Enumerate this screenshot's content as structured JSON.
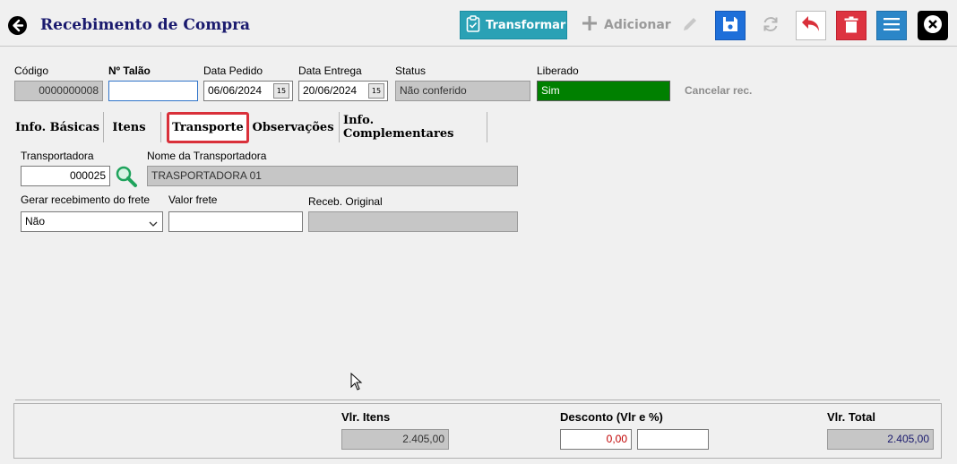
{
  "header": {
    "title": "Recebimento de Compra",
    "transformar_label": "Transformar",
    "adicionar_label": "Adicionar"
  },
  "form": {
    "codigo": {
      "label": "Código",
      "value": "0000000008"
    },
    "talao": {
      "label": "Nº Talão",
      "value": ""
    },
    "data_pedido": {
      "label": "Data Pedido",
      "value": "06/06/2024"
    },
    "data_entrega": {
      "label": "Data Entrega",
      "value": "20/06/2024"
    },
    "status": {
      "label": "Status",
      "value": "Não conferido"
    },
    "liberado": {
      "label": "Liberado",
      "value": "Sim"
    },
    "cancelar_label": "Cancelar rec."
  },
  "tabs": [
    {
      "label": "Info. Básicas"
    },
    {
      "label": "Itens"
    },
    {
      "label": "Transporte"
    },
    {
      "label": "Observações"
    },
    {
      "label": "Info. Complementares"
    }
  ],
  "transporte": {
    "transportadora": {
      "label": "Transportadora",
      "value": "000025"
    },
    "nome": {
      "label": "Nome da Transportadora",
      "value": "TRASPORTADORA 01"
    },
    "gerar_frete": {
      "label": "Gerar recebimento do frete",
      "value": "Não"
    },
    "valor_frete": {
      "label": "Valor frete",
      "value": ""
    },
    "receb_original": {
      "label": "Receb. Original",
      "value": ""
    }
  },
  "footer": {
    "vlr_itens": {
      "label": "Vlr. Itens",
      "value": "2.405,00"
    },
    "desconto": {
      "label": "Desconto (Vlr e %)",
      "value": "0,00",
      "percent": ""
    },
    "vlr_total": {
      "label": "Vlr. Total",
      "value": "2.405,00"
    }
  },
  "colors": {
    "transformar": "#2aa1b5",
    "save": "#1e6fd9",
    "delete": "#dd3340",
    "menu": "#2b86c8",
    "liberado": "#008000",
    "active_tab_outline": "#d9303a"
  }
}
